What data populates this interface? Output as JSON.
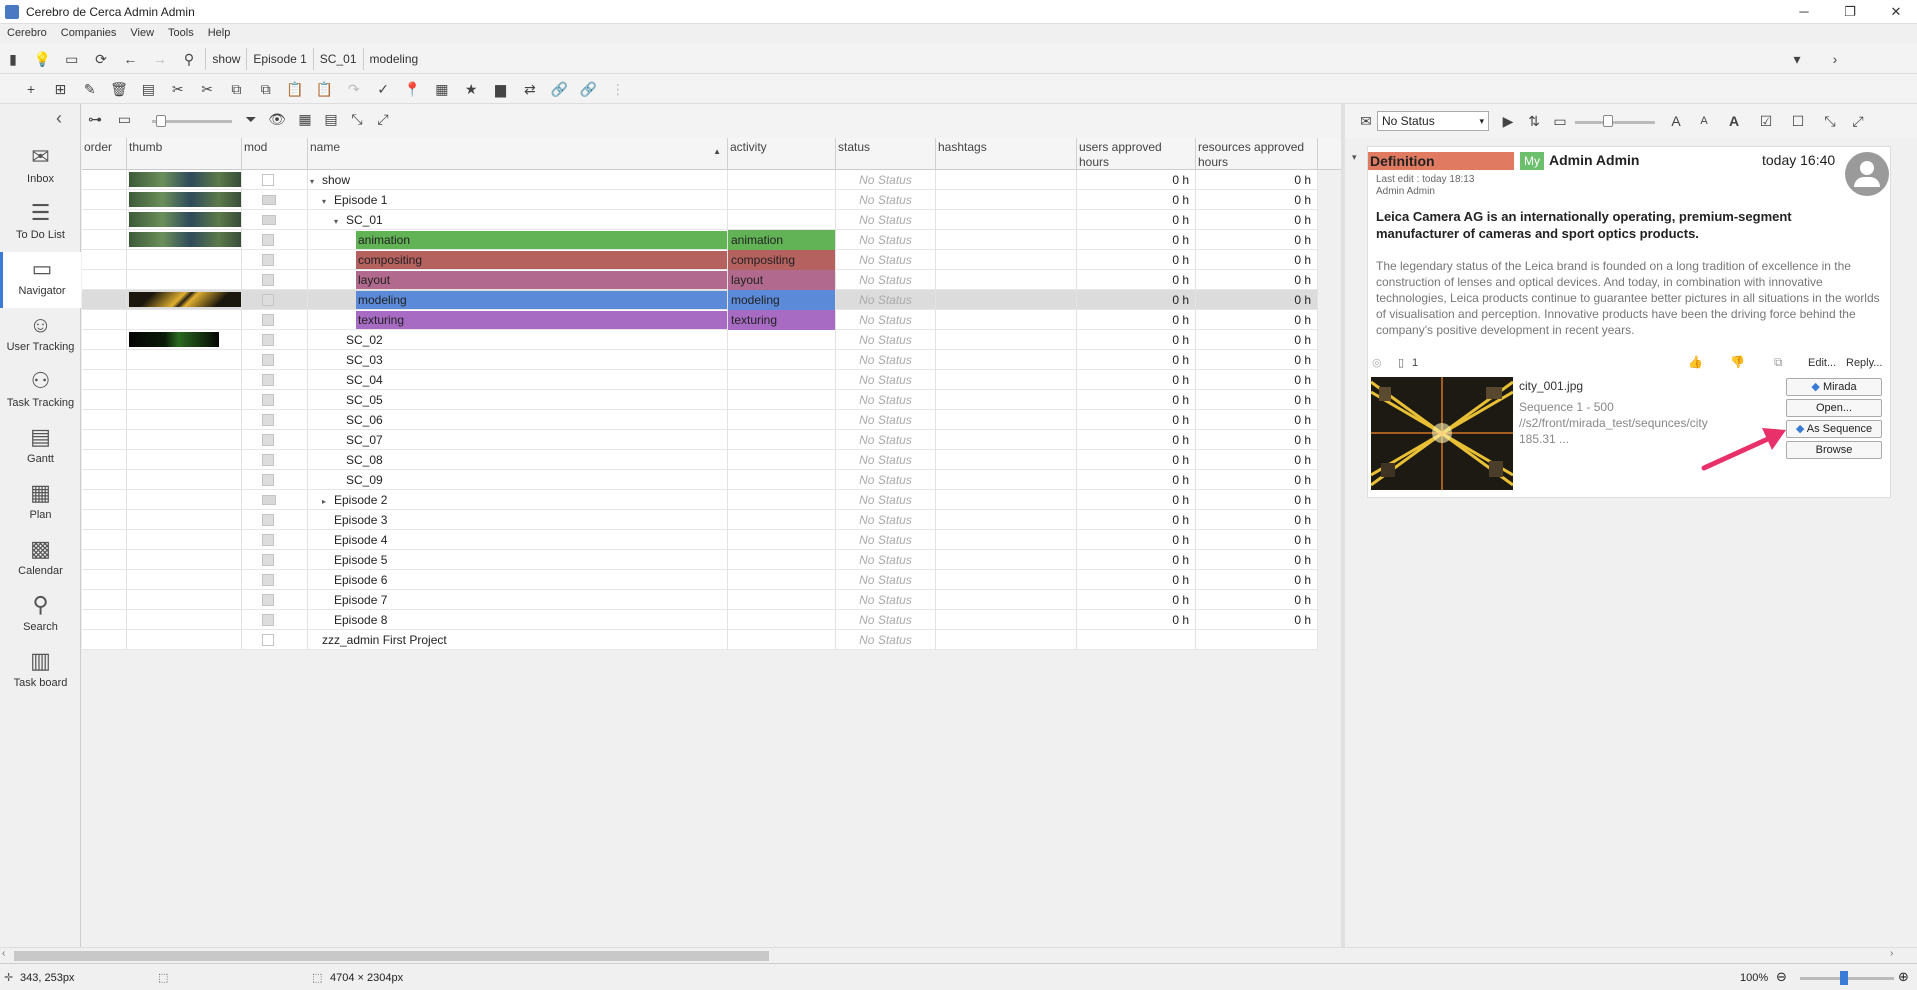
{
  "window": {
    "title": "Cerebro de Cerca  Admin Admin"
  },
  "menu": [
    "Cerebro",
    "Companies",
    "View",
    "Tools",
    "Help"
  ],
  "breadcrumbs": [
    "show",
    "Episode 1",
    "SC_01",
    "modeling"
  ],
  "sidebar": [
    {
      "label": "Inbox",
      "icon": "inbox-icon",
      "glyph": "✉"
    },
    {
      "label": "To Do List",
      "icon": "todo-list-icon",
      "glyph": "☰"
    },
    {
      "label": "Navigator",
      "icon": "folder-icon",
      "glyph": "▭"
    },
    {
      "label": "User Tracking",
      "icon": "user-tracking-icon",
      "glyph": "☺"
    },
    {
      "label": "Task Tracking",
      "icon": "task-tracking-icon",
      "glyph": "⚇"
    },
    {
      "label": "Gantt",
      "icon": "gantt-icon",
      "glyph": "▤"
    },
    {
      "label": "Plan",
      "icon": "plan-icon",
      "glyph": "▦"
    },
    {
      "label": "Calendar",
      "icon": "calendar-icon",
      "glyph": "▩"
    },
    {
      "label": "Search",
      "icon": "search-icon",
      "glyph": "⚲"
    },
    {
      "label": "Task board",
      "icon": "task-board-icon",
      "glyph": "▥"
    }
  ],
  "grid": {
    "columns": {
      "order": "order",
      "thumb": "thumb",
      "mod": "mod",
      "name": "name",
      "activity": "activity",
      "status": "status",
      "hashtags": "hashtags",
      "users_hours": "users approved hours",
      "resources_hours": "resources approved hours"
    },
    "rows": [
      {
        "name": "show",
        "indent": 0,
        "tri": "▾",
        "activity": "",
        "color": "",
        "status": "No Status",
        "u": "0 h",
        "r": "0 h",
        "thumb": "green",
        "mod": "blank"
      },
      {
        "name": "Episode 1",
        "indent": 1,
        "tri": "▾",
        "activity": "",
        "color": "",
        "status": "No Status",
        "u": "0 h",
        "r": "0 h",
        "thumb": "green",
        "mod": "folder"
      },
      {
        "name": "SC_01",
        "indent": 2,
        "tri": "▾",
        "activity": "",
        "color": "",
        "status": "No Status",
        "u": "0 h",
        "r": "0 h",
        "thumb": "green",
        "mod": "folder"
      },
      {
        "name": "animation",
        "indent": 3,
        "tri": "",
        "activity": "animation",
        "color": "#62b356",
        "status": "No Status",
        "u": "0 h",
        "r": "0 h",
        "thumb": "green",
        "mod": "doc"
      },
      {
        "name": "compositing",
        "indent": 3,
        "tri": "",
        "activity": "compositing",
        "color": "#b5615f",
        "status": "No Status",
        "u": "0 h",
        "r": "0 h",
        "thumb": "",
        "mod": "doc"
      },
      {
        "name": "layout",
        "indent": 3,
        "tri": "",
        "activity": "layout",
        "color": "#b16a8e",
        "status": "No Status",
        "u": "0 h",
        "r": "0 h",
        "thumb": "",
        "mod": "doc"
      },
      {
        "name": "modeling",
        "indent": 3,
        "tri": "",
        "activity": "modeling",
        "color": "#5b8ad9",
        "status": "No Status",
        "u": "0 h",
        "r": "0 h",
        "thumb": "city",
        "mod": "doc",
        "selected": true
      },
      {
        "name": "texturing",
        "indent": 3,
        "tri": "",
        "activity": "texturing",
        "color": "#a76bc4",
        "status": "No Status",
        "u": "0 h",
        "r": "0 h",
        "thumb": "",
        "mod": "doc"
      },
      {
        "name": "SC_02",
        "indent": 2,
        "tri": "",
        "activity": "",
        "color": "",
        "status": "No Status",
        "u": "0 h",
        "r": "0 h",
        "thumb": "dark",
        "mod": "doc"
      },
      {
        "name": "SC_03",
        "indent": 2,
        "tri": "",
        "activity": "",
        "color": "",
        "status": "No Status",
        "u": "0 h",
        "r": "0 h",
        "thumb": "",
        "mod": "doc"
      },
      {
        "name": "SC_04",
        "indent": 2,
        "tri": "",
        "activity": "",
        "color": "",
        "status": "No Status",
        "u": "0 h",
        "r": "0 h",
        "thumb": "",
        "mod": "doc"
      },
      {
        "name": "SC_05",
        "indent": 2,
        "tri": "",
        "activity": "",
        "color": "",
        "status": "No Status",
        "u": "0 h",
        "r": "0 h",
        "thumb": "",
        "mod": "doc"
      },
      {
        "name": "SC_06",
        "indent": 2,
        "tri": "",
        "activity": "",
        "color": "",
        "status": "No Status",
        "u": "0 h",
        "r": "0 h",
        "thumb": "",
        "mod": "doc"
      },
      {
        "name": "SC_07",
        "indent": 2,
        "tri": "",
        "activity": "",
        "color": "",
        "status": "No Status",
        "u": "0 h",
        "r": "0 h",
        "thumb": "",
        "mod": "doc"
      },
      {
        "name": "SC_08",
        "indent": 2,
        "tri": "",
        "activity": "",
        "color": "",
        "status": "No Status",
        "u": "0 h",
        "r": "0 h",
        "thumb": "",
        "mod": "doc"
      },
      {
        "name": "SC_09",
        "indent": 2,
        "tri": "",
        "activity": "",
        "color": "",
        "status": "No Status",
        "u": "0 h",
        "r": "0 h",
        "thumb": "",
        "mod": "doc"
      },
      {
        "name": "Episode 2",
        "indent": 1,
        "tri": "▸",
        "activity": "",
        "color": "",
        "status": "No Status",
        "u": "0 h",
        "r": "0 h",
        "thumb": "",
        "mod": "folder"
      },
      {
        "name": "Episode 3",
        "indent": 1,
        "tri": "",
        "activity": "",
        "color": "",
        "status": "No Status",
        "u": "0 h",
        "r": "0 h",
        "thumb": "",
        "mod": "doc"
      },
      {
        "name": "Episode 4",
        "indent": 1,
        "tri": "",
        "activity": "",
        "color": "",
        "status": "No Status",
        "u": "0 h",
        "r": "0 h",
        "thumb": "",
        "mod": "doc"
      },
      {
        "name": "Episode 5",
        "indent": 1,
        "tri": "",
        "activity": "",
        "color": "",
        "status": "No Status",
        "u": "0 h",
        "r": "0 h",
        "thumb": "",
        "mod": "doc"
      },
      {
        "name": "Episode 6",
        "indent": 1,
        "tri": "",
        "activity": "",
        "color": "",
        "status": "No Status",
        "u": "0 h",
        "r": "0 h",
        "thumb": "",
        "mod": "doc"
      },
      {
        "name": "Episode 7",
        "indent": 1,
        "tri": "",
        "activity": "",
        "color": "",
        "status": "No Status",
        "u": "0 h",
        "r": "0 h",
        "thumb": "",
        "mod": "doc"
      },
      {
        "name": "Episode 8",
        "indent": 1,
        "tri": "",
        "activity": "",
        "color": "",
        "status": "No Status",
        "u": "0 h",
        "r": "0 h",
        "thumb": "",
        "mod": "doc"
      },
      {
        "name": "zzz_admin First Project",
        "indent": 0,
        "tri": "",
        "activity": "",
        "color": "",
        "status": "No Status",
        "u": "",
        "r": "",
        "thumb": "",
        "mod": "blank"
      }
    ]
  },
  "right": {
    "status_select": "No Status",
    "message": {
      "type_label": "Definition",
      "my_badge": "My",
      "author": "Admin Admin",
      "time": "today 16:40",
      "last_edit": "Last edit : today 18:13",
      "editor": "Admin Admin",
      "headline": "Leica Camera AG is an internationally operating, premium-segment manufacturer of cameras and sport optics products.",
      "body": "The legendary status of the Leica brand is founded on a long tradition of excellence in the construction of lenses and optical devices. And today, in combination with innovative technologies, Leica products continue to guarantee better pictures in all situations in the worlds of visualisation and perception. Innovative products have been the driving force behind the company's positive development in recent years.",
      "attach_count": "1",
      "edit_link": "Edit...",
      "reply_link": "Reply...",
      "file_name": "city_001.jpg",
      "file_seq": "Sequence 1 - 500",
      "file_path": "//s2/front/mirada_test/sequnces/city",
      "file_size": "185.31 ...",
      "buttons": {
        "mirada": "Mirada",
        "open": "Open...",
        "as_sequence": "As Sequence",
        "browse": "Browse"
      }
    }
  },
  "statusbar": {
    "coords": "343, 253px",
    "size": "4704 × 2304px",
    "zoom": "100%"
  },
  "colors": {
    "accent": "#3a7bd5",
    "definition": "#e07b62",
    "my_badge": "#6cbf6c",
    "arrow": "#e8306b"
  }
}
